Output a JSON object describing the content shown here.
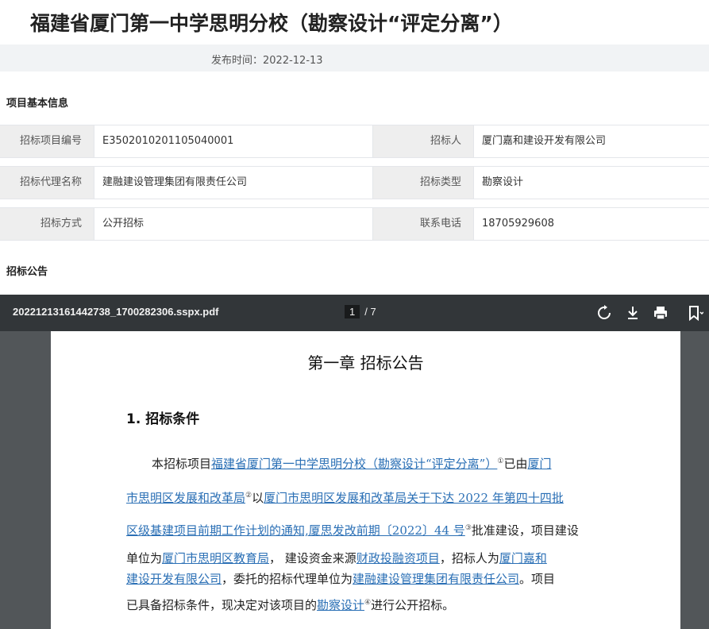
{
  "page": {
    "title": "福建省厦门第一中学思明分校（勘察设计“评定分离”）",
    "publish": "发布时间：2022-12-13"
  },
  "section_basic": "项目基本信息",
  "info": [
    {
      "l1": "招标项目编号",
      "v1": "E3502010201105040001",
      "l2": "招标人",
      "v2": "厦门嘉和建设开发有限公司"
    },
    {
      "l1": "招标代理名称",
      "v1": "建融建设管理集团有限责任公司",
      "l2": "招标类型",
      "v2": "勘察设计"
    },
    {
      "l1": "招标方式",
      "v1": "公开招标",
      "l2": "联系电话",
      "v2": "18705929608"
    }
  ],
  "section_notice": "招标公告",
  "pdf": {
    "filename": "20221213161442738_1700282306.sspx.pdf",
    "page_current": "1",
    "page_total": "/  7",
    "icons": [
      "rotate-icon",
      "download-icon",
      "print-icon",
      "bookmark-icon"
    ]
  },
  "doc": {
    "chapter": "第一章    招标公告",
    "heading": "1.  招标条件",
    "l1_a": "本招标项目",
    "l1_b": "福建省厦门第一中学思明分校（勘察设计“评定分离”）",
    "l1_c": "已由",
    "l1_d": "厦门",
    "l2_a": "市思明区发展和改革局",
    "l2_b": "以",
    "l2_c": "厦门市思明区发展和改革局关于下达 2022 年第四十四批",
    "l3_a": "区级基建项目前期工作计划的通知,厦思发改前期〔2022〕44 号",
    "l3_b": "批准建设，项目建设",
    "l4_a": "单位为",
    "l4_b": "厦门市思明区教育局",
    "l4_c": "，  建设资金来源",
    "l4_d": "财政投融资项目",
    "l4_e": "，招标人为",
    "l4_f": "厦门嘉和",
    "l5_a": "建设开发有限公司",
    "l5_b": "，委托的招标代理单位为",
    "l5_c": "建融建设管理集团有限责任公司",
    "l5_d": "。项目",
    "l6_a": "已具备招标条件，现决定对该项目的",
    "l6_b": "勘察设计",
    "l6_c": "进行公开招标。",
    "sup1": "①",
    "sup2": "②",
    "sup3": "③",
    "sup4": "④"
  }
}
